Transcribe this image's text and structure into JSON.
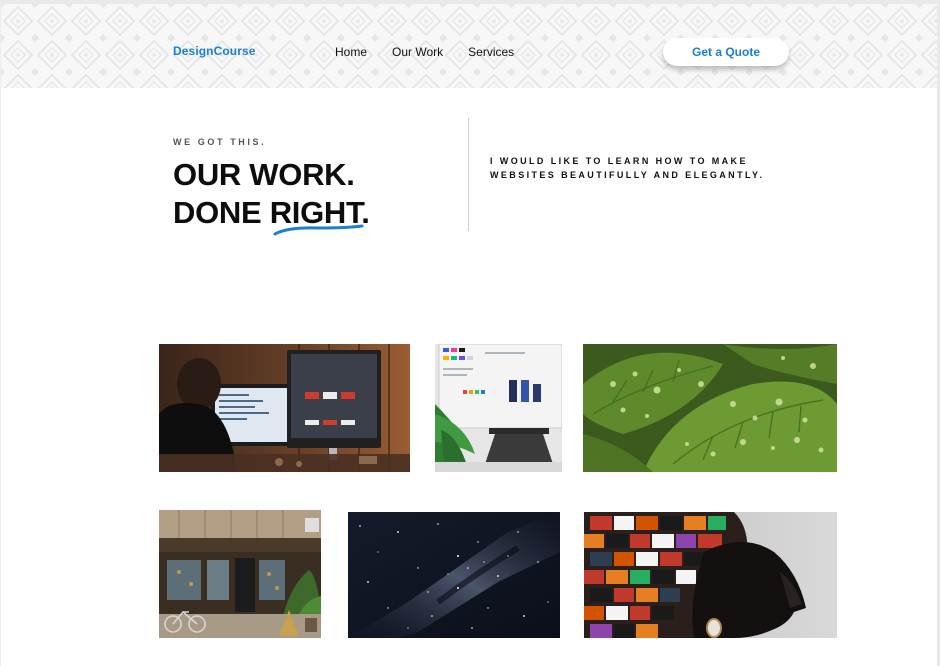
{
  "header": {
    "logo": "DesignCourse",
    "nav": [
      "Home",
      "Our Work",
      "Services"
    ],
    "cta_label": "Get a Quote"
  },
  "hero": {
    "eyebrow": "WE GOT THIS.",
    "headline_line1": "OUR WORK.",
    "headline_line2_prefix": "DONE ",
    "headline_line2_highlight": "RIGHT",
    "headline_line2_suffix": ".",
    "tagline": "I WOULD LIKE TO LEARN HOW TO MAKE WEBSITES BEAUTIFULLY AND ELEGANTLY."
  },
  "colors": {
    "accent": "#1a7fd4",
    "text": "#0d0d0d"
  },
  "gallery": [
    "photo-man-at-computer",
    "photo-monitor-with-plant",
    "photo-wet-green-leaves",
    "photo-storefront",
    "photo-milky-way",
    "photo-woman-headwrap"
  ]
}
